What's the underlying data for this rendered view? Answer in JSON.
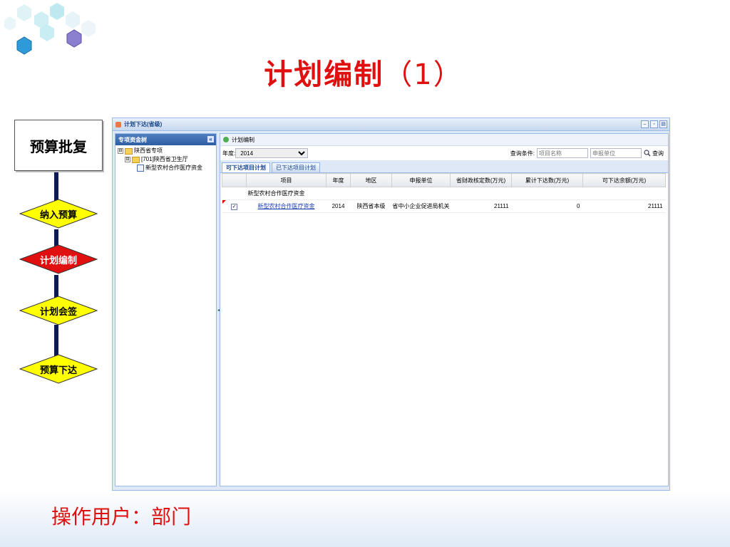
{
  "slide": {
    "title": "计划编制",
    "title_num": "（1）",
    "user_line": "操作用户：部门"
  },
  "flow": {
    "top_box": "预算批复",
    "steps": [
      {
        "label": "纳入预算",
        "fill": "#ffff00",
        "text_color": "#000000"
      },
      {
        "label": "计划编制",
        "fill": "#e01010",
        "text_color": "#ffffff"
      },
      {
        "label": "计划会签",
        "fill": "#ffff00",
        "text_color": "#000000"
      },
      {
        "label": "预算下达",
        "fill": "#ffff00",
        "text_color": "#000000"
      }
    ],
    "line_color": "#0d1a55"
  },
  "app": {
    "window_title": "计划下达(省级)",
    "west_title": "专项资金树",
    "collapse_label": "«",
    "tree": [
      {
        "label": "陕西省专项",
        "toggle": "⊟"
      },
      {
        "label": "[701]陕西省卫生厅",
        "toggle": "⊟"
      },
      {
        "label": "新型农村合作医疗资金"
      }
    ],
    "center_title": "计划编制",
    "year_label": "年度:",
    "year_value": "2014",
    "query_label": "查询条件:",
    "project_placeholder": "项目名称",
    "unit_placeholder": "申报单位",
    "search_label": "查询",
    "tabs": [
      "可下达项目计划",
      "已下达项目计划"
    ],
    "columns": [
      "",
      "项目",
      "年度",
      "地区",
      "申报单位",
      "省财政核定数(万元)",
      "累计下达数(万元)",
      "可下达余额(万元)"
    ],
    "group_label": "新型农村合作医疗资金",
    "rows": [
      {
        "checked": "✓",
        "project": "新型农村合作医疗资金",
        "year": "2014",
        "region": "陕西省本级",
        "unit": "省中小企业促进局机关",
        "approved": "21111",
        "issued": "0",
        "balance": "21111"
      }
    ]
  }
}
